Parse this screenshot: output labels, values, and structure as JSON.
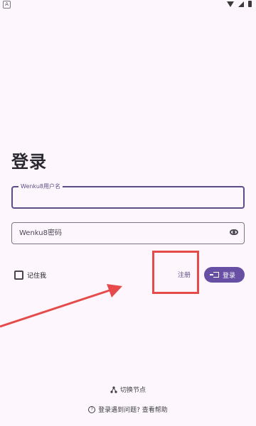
{
  "status_bar": {
    "indicator": "A"
  },
  "page": {
    "title": "登录"
  },
  "username": {
    "label": "Wenku8用户名",
    "value": ""
  },
  "password": {
    "placeholder": "Wenku8密码",
    "value": ""
  },
  "remember": {
    "label": "记住我",
    "checked": false
  },
  "actions": {
    "register_label": "注册",
    "login_label": "登录"
  },
  "footer": {
    "switch_node_label": "切换节点",
    "help_label": "登录遇到问题? 查看帮助"
  },
  "annotation": {
    "highlight_color": "#e64b4b"
  },
  "colors": {
    "accent": "#6750a4",
    "background": "#fdf7fd"
  },
  "icons": {
    "login": "login-arrow-icon",
    "eye": "visibility-icon",
    "node": "node-switch-icon",
    "help": "help-circle-icon"
  }
}
